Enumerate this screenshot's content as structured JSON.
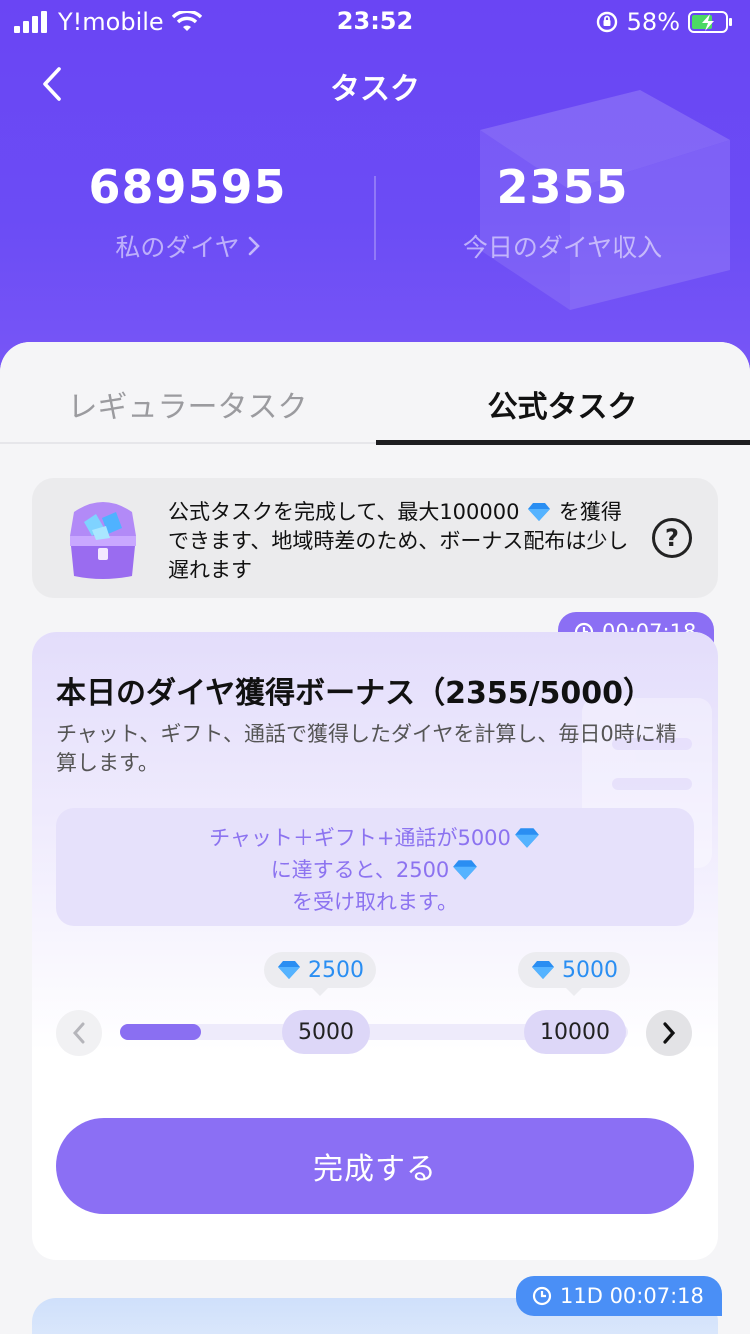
{
  "status": {
    "carrier": "Y!mobile",
    "time": "23:52",
    "battery": "58%"
  },
  "nav": {
    "title": "タスク",
    "back_icon": "chevron-left-icon"
  },
  "stats": {
    "my_diamonds_value": "689595",
    "my_diamonds_label": "私のダイヤ",
    "today_income_value": "2355",
    "today_income_label": "今日のダイヤ収入"
  },
  "tabs": [
    {
      "label": "レギュラータスク",
      "active": false
    },
    {
      "label": "公式タスク",
      "active": true
    }
  ],
  "info": {
    "text_part1": "公式タスクを完成して、最大100000",
    "text_part2": "を獲得できます、地域時差のため、ボーナス配布は少し遅れます",
    "help_label": "?"
  },
  "task": {
    "timer": "00:07:18",
    "title": "本日のダイヤ獲得ボーナス（2355/5000）",
    "description": "チャット、ギフト、通話で獲得したダイヤを計算し、毎日0時に精算します。",
    "hint_line1": "チャット＋ギフト+通話が5000",
    "hint_line2": "に達すると、2500",
    "hint_line3": "を受け取れます。",
    "progress_fraction": 0.16,
    "milestones": [
      {
        "threshold": "5000",
        "reward": "2500"
      },
      {
        "threshold": "10000",
        "reward": "5000"
      }
    ],
    "complete_label": "完成する"
  },
  "next_task": {
    "timer": "11D 00:07:18"
  },
  "colors": {
    "accent": "#8b6ff4",
    "header": "#6a45f4",
    "diamond": "#2a8ef2",
    "blue_badge": "#4a8ff6"
  }
}
